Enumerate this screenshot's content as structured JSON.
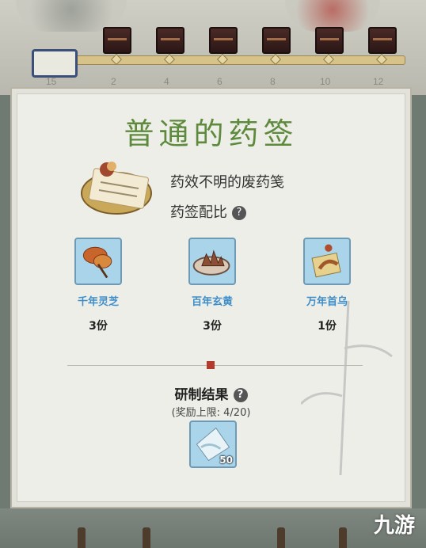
{
  "progress": {
    "milestones": [
      "15",
      "2",
      "4",
      "6",
      "8",
      "10",
      "12"
    ]
  },
  "card": {
    "title": "普通的药签",
    "recipe_name": "药效不明的废药笺",
    "ratio_label": "药签配比",
    "help_glyph": "?",
    "ingredients": [
      {
        "name": "千年灵芝",
        "qty": "3份",
        "icon": "lingzhi-icon"
      },
      {
        "name": "百年玄黄",
        "qty": "3份",
        "icon": "xuanhuang-icon"
      },
      {
        "name": "万年首乌",
        "qty": "1份",
        "icon": "shouwu-icon"
      }
    ],
    "result_title": "研制结果",
    "reward_limit": "(奖励上限: 4/20)",
    "reward_count": "50"
  },
  "colors": {
    "title_green": "#5e8a3d",
    "ingredient_name_blue": "#3e8ec9",
    "item_box_blue": "#a9d4ea"
  },
  "watermark": "九游"
}
